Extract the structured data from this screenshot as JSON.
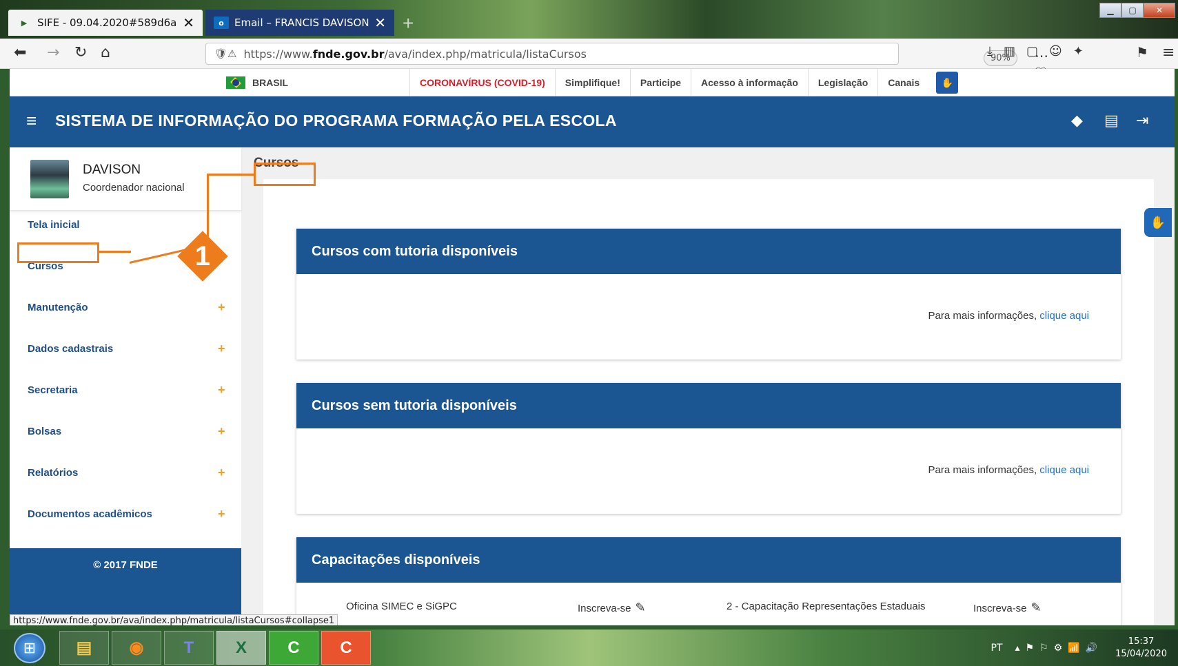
{
  "browser": {
    "tabs": [
      {
        "title": "SIFE - 09.04.2020#589d6a",
        "close": "✕",
        "active": true
      },
      {
        "title": "Email – FRANCIS DAVISON DA",
        "close": "✕",
        "active": false
      }
    ],
    "new_tab": "+",
    "url_prefix": "https://www.",
    "url_domain": "fnde.gov.br",
    "url_path": "/ava/index.php/matricula/listaCursos",
    "zoom": "90%",
    "nav_icons": [
      "back-icon",
      "forward-icon",
      "reload-icon",
      "home-icon"
    ],
    "status_url": "https://www.fnde.gov.br/ava/index.php/matricula/listaCursos#collapse1"
  },
  "govbar": {
    "brasil": "BRASIL",
    "links": [
      "CORONAVÍRUS (COVID-19)",
      "Simplifique!",
      "Participe",
      "Acesso à informação",
      "Legislação",
      "Canais"
    ]
  },
  "header": {
    "title": "SISTEMA DE INFORMAÇÃO DO PROGRAMA FORMAÇÃO PELA ESCOLA",
    "icons": [
      "layers-icon",
      "clipboard-icon",
      "logout-icon"
    ]
  },
  "user": {
    "name": "DAVISON",
    "role": "Coordenador nacional"
  },
  "sidebar": {
    "items": [
      {
        "label": "Tela inicial",
        "expandable": false
      },
      {
        "label": "Cursos",
        "expandable": false
      },
      {
        "label": "Manutenção",
        "expandable": true
      },
      {
        "label": "Dados cadastrais",
        "expandable": true
      },
      {
        "label": "Secretaria",
        "expandable": true
      },
      {
        "label": "Bolsas",
        "expandable": true
      },
      {
        "label": "Relatórios",
        "expandable": true
      },
      {
        "label": "Documentos acadêmicos",
        "expandable": true
      }
    ],
    "plus": "+",
    "footer": "© 2017 FNDE"
  },
  "main": {
    "breadcrumb": "Cursos",
    "panels": [
      {
        "title": "Cursos com tutoria disponíveis",
        "info_text": "Para mais informações, ",
        "info_link": "clique aqui"
      },
      {
        "title": "Cursos sem tutoria disponíveis",
        "info_text": "Para mais informações, ",
        "info_link": "clique aqui"
      },
      {
        "title": "Capacitações disponíveis"
      }
    ],
    "capacitacoes": [
      {
        "name": "Oficina SIMEC e SiGPC",
        "action": "Inscreva-se"
      },
      {
        "name": "2 - Capacitação Representações Estaduais",
        "action": "Inscreva-se"
      }
    ]
  },
  "callout": {
    "number": "1",
    "color": "#ed7d1c"
  },
  "colors": {
    "primary": "#1b5693",
    "link": "#2371c4",
    "covid": "#d1212b",
    "accent_plus": "#f0a020"
  },
  "taskbar": {
    "language": "PT",
    "time": "15:37",
    "date": "15/04/2020",
    "apps": [
      "windows-explorer",
      "firefox",
      "teams",
      "excel",
      "camtasia-green",
      "camtasia-orange"
    ]
  }
}
